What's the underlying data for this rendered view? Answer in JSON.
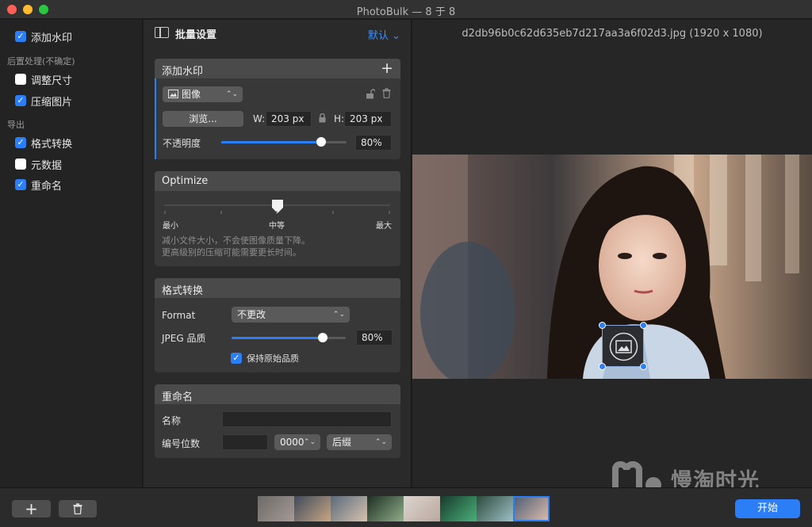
{
  "window": {
    "title": "PhotoBulk — 8 于 8"
  },
  "sidebar": {
    "items": [
      {
        "label": "添加水印",
        "checked": true
      },
      {
        "label": "调整尺寸",
        "checked": false
      },
      {
        "label": "压缩图片",
        "checked": true
      },
      {
        "label": "格式转换",
        "checked": true
      },
      {
        "label": "元数据",
        "checked": false
      },
      {
        "label": "重命名",
        "checked": true
      }
    ],
    "section_post": "后置处理(不确定)",
    "section_export": "导出"
  },
  "middle": {
    "title": "批量设置",
    "preset": "默认",
    "watermark": {
      "header": "添加水印",
      "type_select": "图像",
      "browse_button": "浏览...",
      "w_label": "W:",
      "w_value": "203 px",
      "h_label": "H:",
      "h_value": "203 px",
      "opacity_label": "不透明度",
      "opacity_value": "80%",
      "opacity_fraction": 0.8
    },
    "optimize": {
      "header": "Optimize",
      "min_label": "最小",
      "mid_label": "中等",
      "max_label": "最大",
      "level_fraction": 0.5,
      "desc_line1": "减小文件大小，不会使图像质量下降。",
      "desc_line2": "更高级别的压缩可能需要更长时间。"
    },
    "format": {
      "header": "格式转换",
      "format_label": "Format",
      "format_value": "不更改",
      "jpeg_label": "JPEG 品质",
      "jpeg_value": "80%",
      "jpeg_fraction": 0.8,
      "keep_quality_label": "保持原始品质",
      "keep_quality_checked": true
    },
    "rename": {
      "header": "重命名",
      "name_label": "名称",
      "name_value": "",
      "digits_label": "编号位数",
      "digits_value": "",
      "pattern_select": "0000",
      "suffix_select": "后缀"
    }
  },
  "preview": {
    "filename": "d2db96b0c62d635eb7d217aa3a6f02d3.jpg (1920 x 1080)"
  },
  "bottom": {
    "add_label": "+",
    "start_label": "开始",
    "watermark_text": "慢淘时光"
  },
  "colors": {
    "accent": "#2c7ef7",
    "background": "#1e1e1e"
  }
}
